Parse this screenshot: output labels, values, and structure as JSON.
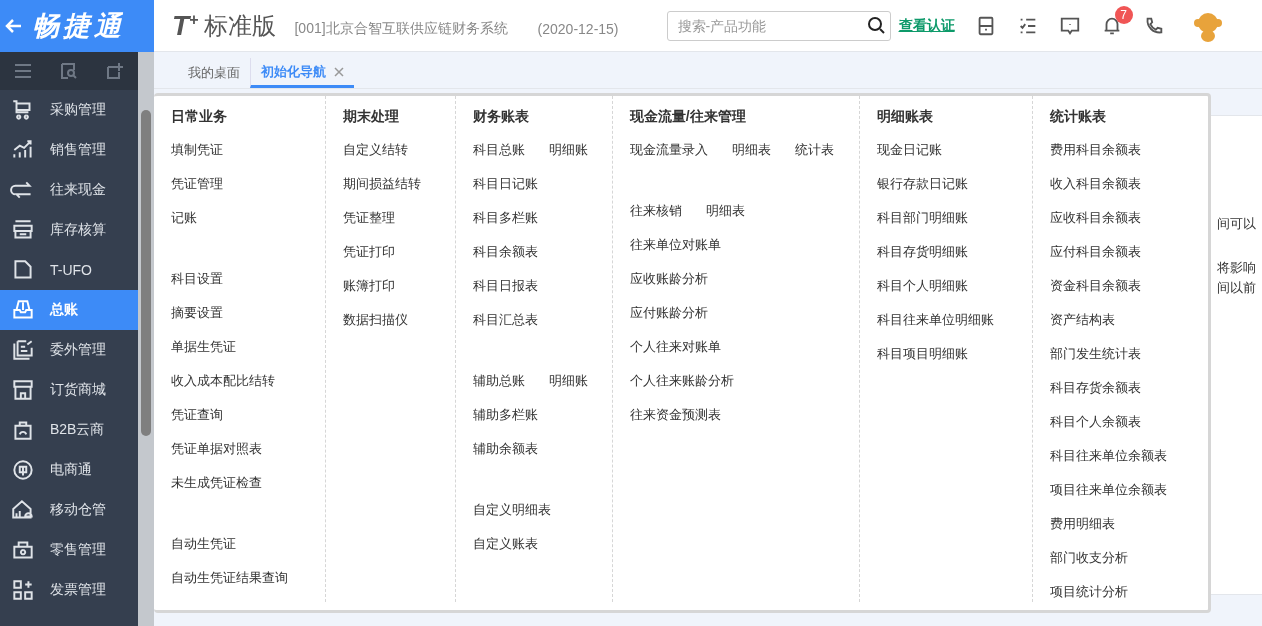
{
  "logo": {
    "text": "畅捷通"
  },
  "header": {
    "brand": "T$^{+}$",
    "product": "标准版",
    "company": "[001]北京合智互联供应链财务系统",
    "date": "(2020-12-15)",
    "search": {
      "placeholder": "搜索-产品功能"
    },
    "link": "查看认证",
    "notification_count": "7"
  },
  "sidebar": {
    "items": [
      {
        "label": "采购管理",
        "selected": false
      },
      {
        "label": "销售管理",
        "selected": false
      },
      {
        "label": "往来现金",
        "selected": false
      },
      {
        "label": "库存核算",
        "selected": false
      },
      {
        "label": "T-UFO",
        "selected": false
      },
      {
        "label": "总账",
        "selected": true
      },
      {
        "label": "委外管理",
        "selected": false
      },
      {
        "label": "订货商城",
        "selected": false
      },
      {
        "label": "B2B云商",
        "selected": false
      },
      {
        "label": "电商通",
        "selected": false
      },
      {
        "label": "移动仓管",
        "selected": false
      },
      {
        "label": "零售管理",
        "selected": false
      },
      {
        "label": "发票管理",
        "selected": false
      }
    ]
  },
  "tabs": [
    {
      "label": "我的桌面",
      "selected": false,
      "closable": false
    },
    {
      "label": "初始化导航",
      "selected": true,
      "closable": true
    }
  ],
  "background_text": [
    "间可以",
    "将影响",
    "间以前"
  ],
  "menu": {
    "columns": [
      {
        "title": "日常业务",
        "groups": [
          [
            [
              "填制凭证"
            ],
            [
              "凭证管理"
            ],
            [
              "记账"
            ]
          ],
          [
            [
              "科目设置"
            ],
            [
              "摘要设置"
            ],
            [
              "单据生凭证"
            ],
            [
              "收入成本配比结转"
            ],
            [
              "凭证查询"
            ],
            [
              "凭证单据对照表"
            ],
            [
              "未生成凭证检查"
            ]
          ],
          [
            [
              "自动生凭证"
            ],
            [
              "自动生凭证结果查询"
            ]
          ]
        ]
      },
      {
        "title": "期末处理",
        "groups": [
          [
            [
              "自定义结转"
            ],
            [
              "期间损益结转"
            ],
            [
              "凭证整理"
            ],
            [
              "凭证打印"
            ],
            [
              "账簿打印"
            ],
            [
              "数据扫描仪"
            ]
          ]
        ]
      },
      {
        "title": "财务账表",
        "groups": [
          [
            [
              "科目总账",
              "明细账"
            ],
            [
              "科目日记账"
            ],
            [
              "科目多栏账"
            ],
            [
              "科目余额表"
            ],
            [
              "科目日报表"
            ],
            [
              "科目汇总表"
            ]
          ],
          [
            [
              "辅助总账",
              "明细账"
            ],
            [
              "辅助多栏账"
            ],
            [
              "辅助余额表"
            ]
          ],
          [
            [
              "自定义明细表"
            ],
            [
              "自定义账表"
            ]
          ]
        ]
      },
      {
        "title": "现金流量/往来管理",
        "groups": [
          [
            [
              "现金流量录入",
              "明细表",
              "统计表"
            ]
          ],
          [
            [
              "往来核销",
              "明细表"
            ],
            [
              "往来单位对账单"
            ],
            [
              "应收账龄分析"
            ],
            [
              "应付账龄分析"
            ],
            [
              "个人往来对账单"
            ],
            [
              "个人往来账龄分析"
            ],
            [
              "往来资金预测表"
            ]
          ]
        ]
      },
      {
        "title": "明细账表",
        "groups": [
          [
            [
              "现金日记账"
            ],
            [
              "银行存款日记账"
            ],
            [
              "科目部门明细账"
            ],
            [
              "科目存货明细账"
            ],
            [
              "科目个人明细账"
            ],
            [
              "科目往来单位明细账"
            ],
            [
              "科目项目明细账"
            ]
          ]
        ]
      },
      {
        "title": "统计账表",
        "groups": [
          [
            [
              "费用科目余额表"
            ],
            [
              "收入科目余额表"
            ],
            [
              "应收科目余额表"
            ],
            [
              "应付科目余额表"
            ],
            [
              "资金科目余额表"
            ],
            [
              "资产结构表"
            ],
            [
              "部门发生统计表"
            ],
            [
              "科目存货余额表"
            ],
            [
              "科目个人余额表"
            ],
            [
              "科目往来单位余额表"
            ],
            [
              "项目往来单位余额表"
            ],
            [
              "费用明细表"
            ],
            [
              "部门收支分析"
            ],
            [
              "项目统计分析"
            ]
          ]
        ]
      }
    ]
  }
}
